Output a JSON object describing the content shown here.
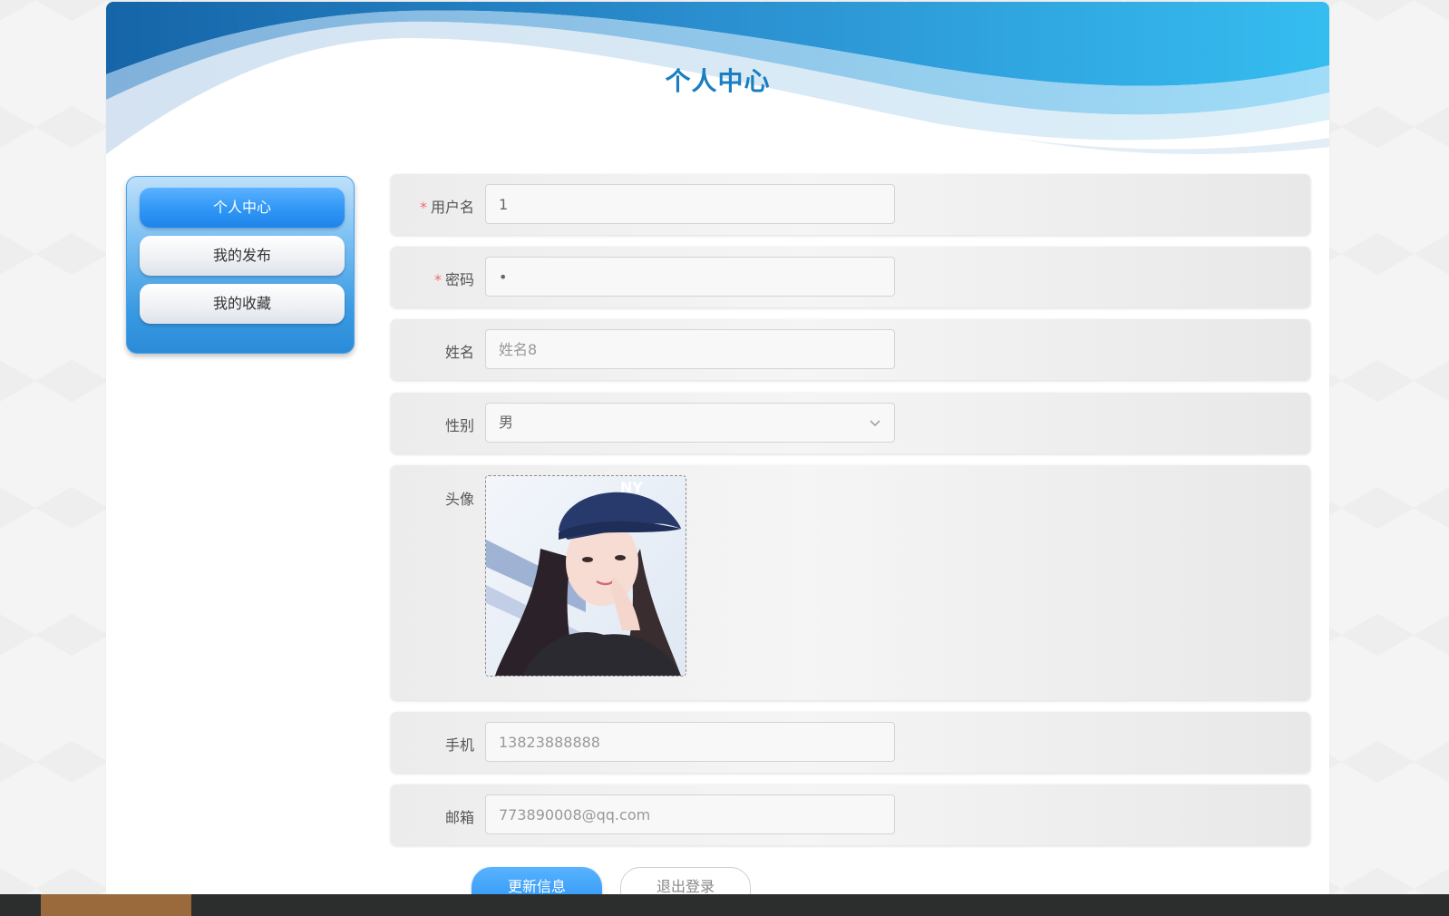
{
  "header": {
    "title": "个人中心"
  },
  "sidebar": {
    "items": [
      {
        "label": "个人中心",
        "active": true
      },
      {
        "label": "我的发布",
        "active": false
      },
      {
        "label": "我的收藏",
        "active": false
      }
    ]
  },
  "form": {
    "username": {
      "label": "用户名",
      "required_mark": "*",
      "value": "1"
    },
    "password": {
      "label": "密码",
      "required_mark": "*",
      "value": "•"
    },
    "name": {
      "label": "姓名",
      "placeholder": "姓名8"
    },
    "gender": {
      "label": "性别",
      "value": "男"
    },
    "avatar": {
      "label": "头像"
    },
    "phone": {
      "label": "手机",
      "placeholder": "13823888888"
    },
    "email": {
      "label": "邮箱",
      "placeholder": "773890008@qq.com"
    }
  },
  "actions": {
    "update_label": "更新信息",
    "logout_label": "退出登录"
  },
  "colors": {
    "accent": "#2f95f4",
    "title": "#1a7fc1",
    "required": "#f56c6c"
  }
}
